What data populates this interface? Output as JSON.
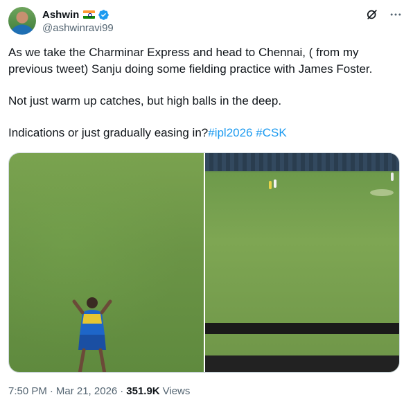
{
  "author": {
    "display_name": "Ashwin",
    "handle": "@ashwinravi99",
    "flag_icon": "india-flag-icon",
    "verified_color": "#1d9bf0"
  },
  "tweet": {
    "paragraph_1": "As we take the Charminar Express and head to Chennai, ( from my previous tweet) Sanju doing some fielding practice with James Foster.",
    "paragraph_2": "Not just warm up catches, but high balls in the deep.",
    "paragraph_3_text": "Indications or just gradually easing in?",
    "hashtag_1": "#ipl2026",
    "hashtag_2": "#CSK",
    "hashtag_color": "#1d9bf0"
  },
  "meta": {
    "time": "7:50 PM",
    "separator": "·",
    "date": "Mar 21, 2026",
    "views_count": "351.9K",
    "views_label": "Views"
  },
  "actions": {
    "grok_icon": "grok-icon",
    "more_icon": "more-icon"
  }
}
